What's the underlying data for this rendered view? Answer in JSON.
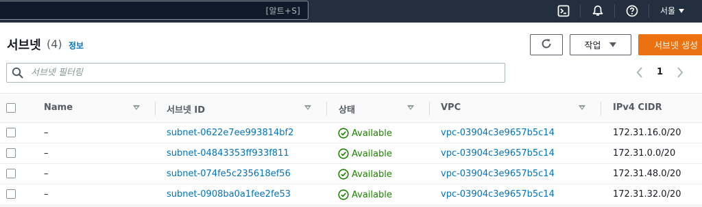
{
  "topnav": {
    "search_shortcut": "[알트+S]",
    "region": "서울",
    "icons": [
      "cloudshell-icon",
      "notifications-icon",
      "help-icon"
    ]
  },
  "header": {
    "title": "서브넷",
    "count": "(4)",
    "info": "정보",
    "actions_label": "작업",
    "create_label": "서브넷 생성"
  },
  "filter": {
    "placeholder": "서브넷 필터링"
  },
  "pagination": {
    "current_page": "1"
  },
  "table": {
    "columns": [
      "Name",
      "서브넷 ID",
      "상태",
      "VPC",
      "IPv4 CIDR"
    ],
    "rows": [
      {
        "name": "–",
        "subnet_id": "subnet-0622e7ee993814bf2",
        "status": "Available",
        "vpc": "vpc-03904c3e9657b5c14",
        "cidr": "172.31.16.0/20"
      },
      {
        "name": "–",
        "subnet_id": "subnet-04843353ff933f811",
        "status": "Available",
        "vpc": "vpc-03904c3e9657b5c14",
        "cidr": "172.31.0.0/20"
      },
      {
        "name": "–",
        "subnet_id": "subnet-074fe5c235618ef56",
        "status": "Available",
        "vpc": "vpc-03904c3e9657b5c14",
        "cidr": "172.31.48.0/20"
      },
      {
        "name": "–",
        "subnet_id": "subnet-0908ba0a1fee2fe53",
        "status": "Available",
        "vpc": "vpc-03904c3e9657b5c14",
        "cidr": "172.31.32.0/20"
      }
    ]
  },
  "colors": {
    "nav_bg": "#232f3e",
    "link": "#0073bb",
    "primary_button": "#ec7211",
    "status_available": "#1d8102"
  }
}
